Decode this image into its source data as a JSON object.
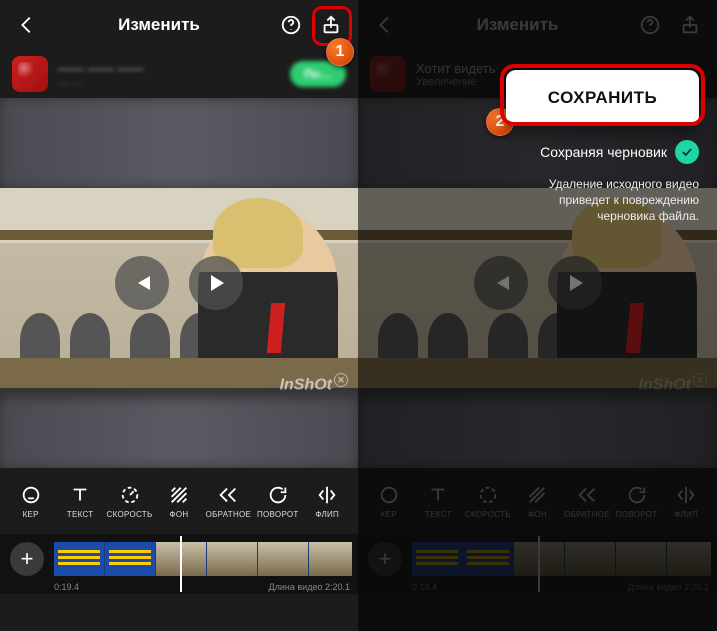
{
  "header": {
    "title": "Изменить"
  },
  "ad": {
    "left_title": "—— —— ——",
    "left_sub": "… …",
    "left_cta": "По…",
    "right_title": "Хотит видеть",
    "right_sub": "Увеличение"
  },
  "watermark": "InShOt",
  "play": {
    "prev": "Предыдущий",
    "play": "Воспроизвести"
  },
  "tools": [
    {
      "label": "КЕР"
    },
    {
      "label": "ТЕКСТ"
    },
    {
      "label": "СКОРОСТЬ"
    },
    {
      "label": "ФОН"
    },
    {
      "label": "ОБРАТНОЕ"
    },
    {
      "label": "ПОВОРОТ"
    },
    {
      "label": "ФЛИП"
    }
  ],
  "timeline": {
    "current": "0:19.4",
    "total_prefix": "Длина видео ",
    "total": "2:20.1"
  },
  "save": {
    "button": "СОХРАНИТЬ",
    "draft": "Сохраняя черновик",
    "warn": "Удаление исходного видео приведет к повреждению черновика файла."
  },
  "callouts": {
    "one": "1",
    "two": "2"
  }
}
